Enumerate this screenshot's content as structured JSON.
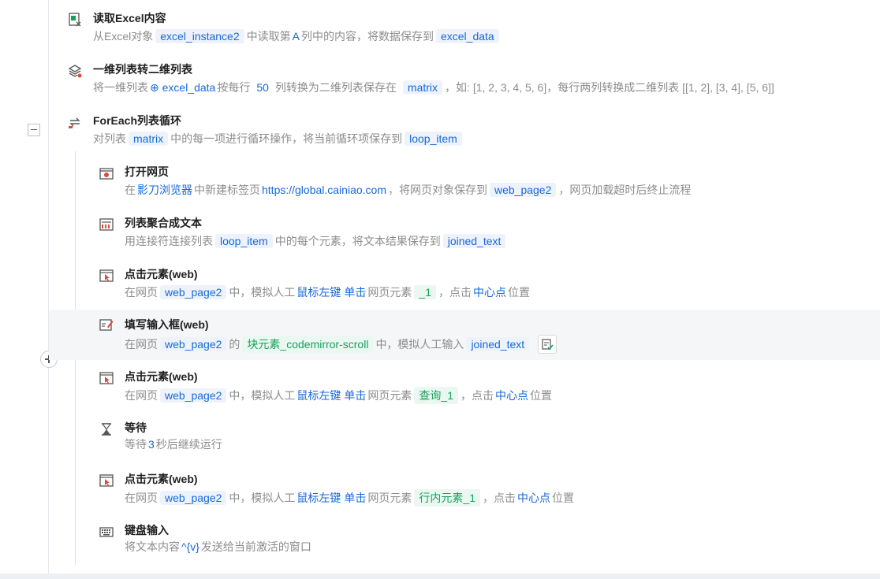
{
  "steps": [
    {
      "title": "读取Excel内容",
      "parts": [
        "从Excel对象",
        "excel_instance2",
        "中读取第",
        "A",
        "列中的内容，将数据保存到",
        "excel_data"
      ]
    },
    {
      "title": "一维列表转二维列表",
      "parts": [
        "将一维列表",
        "excel_data",
        "按每行",
        "50",
        "列转换为二维列表保存在",
        "matrix",
        "，如: [1, 2, 3, 4, 5, 6]，每行两列转换成二维列表 [[1, 2], [3, 4], [5, 6]]"
      ]
    },
    {
      "title": "ForEach列表循环",
      "parts": [
        "对列表",
        "matrix",
        "中的每一项进行循环操作，将当前循环项保存到",
        "loop_item"
      ]
    },
    {
      "title": "打开网页",
      "parts": [
        "在",
        "影刀浏览器",
        "中新建标签页",
        "https://global.cainiao.com",
        "，将网页对象保存到",
        "web_page2",
        "，网页加载超时后终止流程"
      ]
    },
    {
      "title": "列表聚合成文本",
      "parts": [
        "用连接符连接列表",
        "loop_item",
        "中的每个元素，将文本结果保存到",
        "joined_text"
      ]
    },
    {
      "title": "点击元素(web)",
      "parts": [
        "在网页",
        "web_page2",
        "中，模拟人工",
        "鼠标左键",
        "单击",
        "网页元素",
        "_1",
        "，点击",
        "中心点",
        "位置"
      ]
    },
    {
      "title": "填写输入框(web)",
      "parts": [
        "在网页",
        "web_page2",
        "的",
        "块元素_codemirror-scroll",
        "中，模拟人工输入",
        "joined_text"
      ]
    },
    {
      "title": "点击元素(web)",
      "parts": [
        "在网页",
        "web_page2",
        "中，模拟人工",
        "鼠标左键",
        "单击",
        "网页元素",
        "查询_1",
        "，点击",
        "中心点",
        "位置"
      ]
    },
    {
      "title": "等待",
      "parts": [
        "等待",
        "3",
        "秒后继续运行"
      ]
    },
    {
      "title": "点击元素(web)",
      "parts": [
        "在网页",
        "web_page2",
        "中，模拟人工",
        "鼠标左键",
        "单击",
        "网页元素",
        "行内元素_1",
        "，点击",
        "中心点",
        "位置"
      ]
    },
    {
      "title": "键盘输入",
      "parts": [
        "将文本内容",
        "^{v}",
        "发送给当前激活的窗口"
      ]
    }
  ],
  "colors": {
    "accent": "#1668dc",
    "green": "#17a05d",
    "muted": "#8c8c8c",
    "highlight": "#f5f6f8"
  }
}
